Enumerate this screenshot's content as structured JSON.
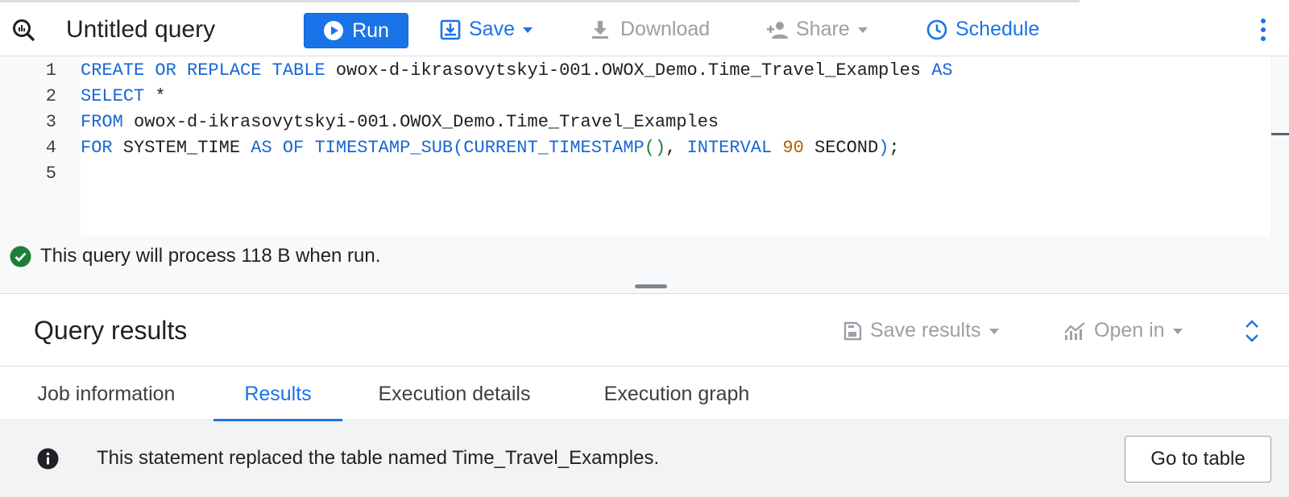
{
  "toolbar": {
    "title": "Untitled query",
    "run_label": "Run",
    "save_label": "Save",
    "download_label": "Download",
    "share_label": "Share",
    "schedule_label": "Schedule"
  },
  "editor": {
    "line_numbers": [
      "1",
      "2",
      "3",
      "4",
      "5"
    ],
    "lines": [
      [
        {
          "t": "CREATE OR REPLACE TABLE",
          "c": "kw"
        },
        {
          "t": " owox-d-ikrasovytskyi-001.OWOX_Demo.Time_Travel_Examples ",
          "c": "id"
        },
        {
          "t": "AS",
          "c": "kw"
        }
      ],
      [
        {
          "t": "SELECT",
          "c": "kw"
        },
        {
          "t": " *",
          "c": "id"
        }
      ],
      [
        {
          "t": "FROM",
          "c": "kw"
        },
        {
          "t": " owox-d-ikrasovytskyi-001.OWOX_Demo.Time_Travel_Examples",
          "c": "id"
        }
      ],
      [
        {
          "t": "FOR",
          "c": "kw"
        },
        {
          "t": " SYSTEM_TIME ",
          "c": "id"
        },
        {
          "t": "AS OF",
          "c": "kw"
        },
        {
          "t": " ",
          "c": "id"
        },
        {
          "t": "TIMESTAMP_SUB(CURRENT_TIMESTAMP",
          "c": "fn"
        },
        {
          "t": "()",
          "c": "par"
        },
        {
          "t": ", ",
          "c": "id"
        },
        {
          "t": "INTERVAL",
          "c": "kw"
        },
        {
          "t": " ",
          "c": "id"
        },
        {
          "t": "90",
          "c": "num"
        },
        {
          "t": " SECOND",
          "c": "id"
        },
        {
          "t": ")",
          "c": "fn"
        },
        {
          "t": ";",
          "c": "id"
        }
      ],
      []
    ]
  },
  "status": {
    "message": "This query will process 118 B when run."
  },
  "results": {
    "title": "Query results",
    "save_results_label": "Save results",
    "open_in_label": "Open in"
  },
  "tabs": [
    {
      "label": "Job information",
      "active": false
    },
    {
      "label": "Results",
      "active": true
    },
    {
      "label": "Execution details",
      "active": false
    },
    {
      "label": "Execution graph",
      "active": false
    }
  ],
  "info": {
    "message": "This statement replaced the table named Time_Travel_Examples.",
    "goto_label": "Go to table"
  },
  "colors": {
    "accent": "#1a73e8",
    "success": "#188038",
    "keyword": "#1967d2",
    "number": "#b06000",
    "disabled": "#9aa0a6"
  }
}
